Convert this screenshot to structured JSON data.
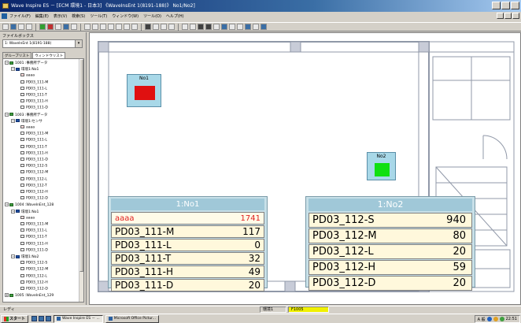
{
  "window": {
    "title": "Wave Inspire ES － [ECM 環境1 - 日本3]  《WaveInsEnt 1(8191-188)》 No1/No2]",
    "menu": [
      "ファイル(F)",
      "編集(E)",
      "表示(V)",
      "検索(S)",
      "ツール(T)",
      "ウィンドウ(W)",
      "ツール(O)",
      "ヘルプ(H)"
    ]
  },
  "left_panel": {
    "label": "ファイルボックス",
    "combo_value": "1: WaveInEnt 1(8191-188)",
    "tabs": [
      "グループリスト",
      "ウィンドウリスト"
    ],
    "active_tab": 1,
    "tree": [
      {
        "text": "1001 :事務所データ",
        "level": 0,
        "kind": "pc",
        "exp": "−"
      },
      {
        "text": "環境1:No1",
        "level": 1,
        "kind": "group",
        "exp": "−"
      },
      {
        "text": "aaaa",
        "level": 2,
        "kind": "doc-r"
      },
      {
        "text": "PD03_111-M",
        "level": 2,
        "kind": "doc"
      },
      {
        "text": "PD03_111-L",
        "level": 2,
        "kind": "doc"
      },
      {
        "text": "PD03_111-T",
        "level": 2,
        "kind": "doc"
      },
      {
        "text": "PD03_111-H",
        "level": 2,
        "kind": "doc"
      },
      {
        "text": "PD03_111-D",
        "level": 2,
        "kind": "doc"
      },
      {
        "text": "1003 :事務所データ",
        "level": 0,
        "kind": "pc",
        "exp": "−"
      },
      {
        "text": "環境1:センサ",
        "level": 1,
        "kind": "group",
        "exp": "−"
      },
      {
        "text": "aaaa",
        "level": 2,
        "kind": "doc-r"
      },
      {
        "text": "PD03_111-M",
        "level": 2,
        "kind": "doc"
      },
      {
        "text": "PD03_111-L",
        "level": 2,
        "kind": "doc"
      },
      {
        "text": "PD03_111-T",
        "level": 2,
        "kind": "doc"
      },
      {
        "text": "PD03_111-H",
        "level": 2,
        "kind": "doc"
      },
      {
        "text": "PD03_111-D",
        "level": 2,
        "kind": "doc"
      },
      {
        "text": "PD03_112-S",
        "level": 2,
        "kind": "doc"
      },
      {
        "text": "PD03_112-M",
        "level": 2,
        "kind": "doc"
      },
      {
        "text": "PD03_112-L",
        "level": 2,
        "kind": "doc"
      },
      {
        "text": "PD03_112-T",
        "level": 2,
        "kind": "doc"
      },
      {
        "text": "PD03_112-H",
        "level": 2,
        "kind": "doc"
      },
      {
        "text": "PD03_112-D",
        "level": 2,
        "kind": "doc"
      },
      {
        "text": "1004 :WaveInEnt_128",
        "level": 0,
        "kind": "pc",
        "exp": "−"
      },
      {
        "text": "環境1:No1",
        "level": 1,
        "kind": "group",
        "exp": "−"
      },
      {
        "text": "aaaa",
        "level": 2,
        "kind": "doc-r"
      },
      {
        "text": "PD03_111-M",
        "level": 2,
        "kind": "doc"
      },
      {
        "text": "PD03_111-L",
        "level": 2,
        "kind": "doc"
      },
      {
        "text": "PD03_111-T",
        "level": 2,
        "kind": "doc"
      },
      {
        "text": "PD03_111-H",
        "level": 2,
        "kind": "doc"
      },
      {
        "text": "PD03_111-D",
        "level": 2,
        "kind": "doc"
      },
      {
        "text": "環境1:No2",
        "level": 1,
        "kind": "group",
        "exp": "−"
      },
      {
        "text": "PD03_112-S",
        "level": 2,
        "kind": "doc"
      },
      {
        "text": "PD03_112-M",
        "level": 2,
        "kind": "doc"
      },
      {
        "text": "PD03_112-L",
        "level": 2,
        "kind": "doc"
      },
      {
        "text": "PD03_112-H",
        "level": 2,
        "kind": "doc"
      },
      {
        "text": "PD03_112-D",
        "level": 2,
        "kind": "doc"
      },
      {
        "text": "1005 :WaveInEnt_129",
        "level": 0,
        "kind": "pc",
        "exp": "+"
      }
    ]
  },
  "sensors": [
    {
      "name": "No1",
      "light_color": "#e01010"
    },
    {
      "name": "No2",
      "light_color": "#10e010"
    }
  ],
  "panels": [
    {
      "title": "1:No1",
      "rows": [
        {
          "label": "aaaa",
          "value": "1741",
          "alarm": true
        },
        {
          "label": "PD03_111-M",
          "value": "117"
        },
        {
          "label": "PD03_111-L",
          "value": "0"
        },
        {
          "label": "PD03_111-T",
          "value": "32"
        },
        {
          "label": "PD03_111-H",
          "value": "49"
        },
        {
          "label": "PD03_111-D",
          "value": "20"
        }
      ]
    },
    {
      "title": "1:No2",
      "rows": [
        {
          "label": "PD03_112-S",
          "value": "940"
        },
        {
          "label": "PD03_112-M",
          "value": "80"
        },
        {
          "label": "PD03_112-L",
          "value": "20"
        },
        {
          "label": "PD03_112-H",
          "value": "59"
        },
        {
          "label": "PD03_112-D",
          "value": "20"
        }
      ]
    }
  ],
  "statusbar": {
    "left": "レディ",
    "cell1": "環境1",
    "cell2": "F1005",
    "cell2_color": "#f0f000"
  },
  "taskbar": {
    "start": "スタート",
    "tasks": [
      {
        "label": "Wave Inspire ES － ...",
        "active": true
      },
      {
        "label": "Microsoft Office Pictur...",
        "active": false
      }
    ],
    "tray_ime": "A 般",
    "clock": "22:51"
  },
  "colors": {
    "title_gradient_start": "#0a246a",
    "panel_header": "#a0c8d8",
    "row_bg": "#fff8dc",
    "alarm_text": "#e02020"
  }
}
